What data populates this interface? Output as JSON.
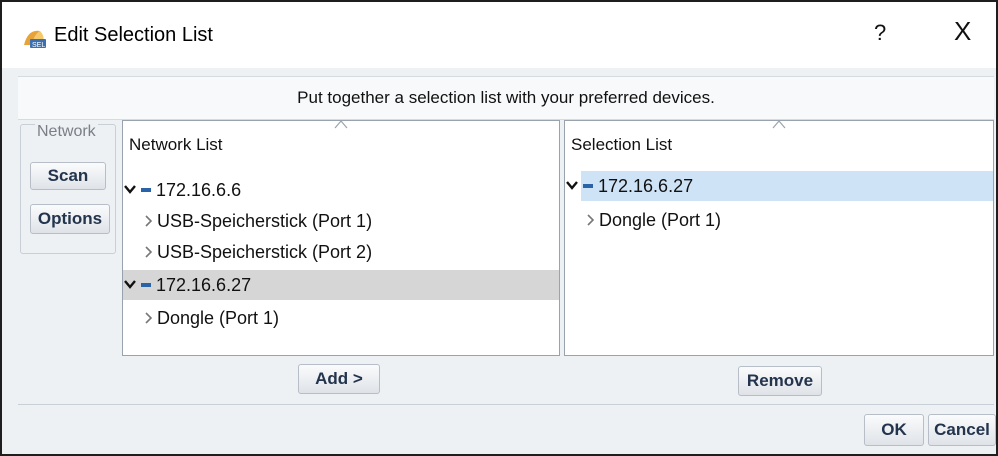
{
  "window": {
    "title": "Edit Selection List",
    "help_label": "?",
    "close_label": "X"
  },
  "banner": {
    "text": "Put together a selection list with your preferred devices."
  },
  "network_group": {
    "legend": "Network",
    "scan_label": "Scan",
    "options_label": "Options"
  },
  "network_list": {
    "header": "Network List",
    "items": [
      {
        "label": "172.16.6.6",
        "kind": "host",
        "expanded": true,
        "selected": false
      },
      {
        "label": "USB-Speicherstick (Port 1)",
        "kind": "device",
        "selected": false
      },
      {
        "label": "USB-Speicherstick (Port 2)",
        "kind": "device",
        "selected": false
      },
      {
        "label": "172.16.6.27",
        "kind": "host",
        "expanded": true,
        "selected": true
      },
      {
        "label": "Dongle (Port 1)",
        "kind": "device",
        "selected": false
      }
    ]
  },
  "selection_list": {
    "header": "Selection List",
    "items": [
      {
        "label": "172.16.6.27",
        "kind": "host",
        "expanded": true,
        "selected": true
      },
      {
        "label": "Dongle (Port 1)",
        "kind": "device",
        "selected": false
      }
    ]
  },
  "actions": {
    "add_label": "Add >",
    "remove_label": "Remove",
    "ok_label": "OK",
    "cancel_label": "Cancel"
  },
  "colors": {
    "accent_blue": "#2a63a8",
    "selection_gray": "#d6d6d6",
    "selection_blue": "#cfe3f7",
    "button_text": "#23344d"
  }
}
